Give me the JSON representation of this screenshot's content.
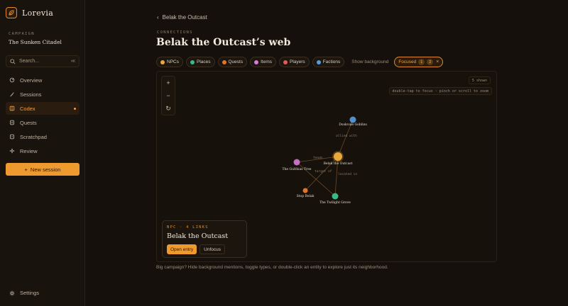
{
  "app": {
    "name": "Lorevia"
  },
  "campaign": {
    "label": "CAMPAIGN",
    "name": "The Sunken Citadel"
  },
  "search": {
    "placeholder": "Search...",
    "shortcut": "⌘K"
  },
  "nav": [
    {
      "label": "Overview",
      "icon": "grid-icon"
    },
    {
      "label": "Sessions",
      "icon": "quill-icon"
    },
    {
      "label": "Codex",
      "icon": "book-icon",
      "active": true
    },
    {
      "label": "Quests",
      "icon": "scroll-icon"
    },
    {
      "label": "Scratchpad",
      "icon": "note-icon"
    },
    {
      "label": "Review",
      "icon": "sparkle-icon"
    }
  ],
  "new_session": "New session",
  "settings": "Settings",
  "breadcrumb": {
    "back": "Belak the Outcast"
  },
  "page": {
    "eyebrow": "CONNECTIONS",
    "title": "Belak the Outcast’s web"
  },
  "filters": [
    {
      "label": "NPCs",
      "color": "#e8a93a"
    },
    {
      "label": "Places",
      "color": "#3ab88a"
    },
    {
      "label": "Quests",
      "color": "#e0742a"
    },
    {
      "label": "Items",
      "color": "#d77ad8"
    },
    {
      "label": "Players",
      "color": "#e05a5a"
    },
    {
      "label": "Factions",
      "color": "#5a9be0"
    }
  ],
  "show_background": "Show background",
  "focused": {
    "label": "Focused",
    "depth1": "1",
    "depth2": "2",
    "close": "×"
  },
  "graph": {
    "shown": "5 shown",
    "hint": "double-tap to focus · pinch or scroll to zoom",
    "zoom_in": "+",
    "zoom_out": "−",
    "reset": "↻",
    "nodes": {
      "center": "Belak the Outcast",
      "goblins": "Duskvale Goblins",
      "tree": "The Gulthias Tree",
      "stop": "Stop Belak",
      "grove": "The Twilight Grove"
    },
    "edges": {
      "allied": "allied with",
      "tends": "tends",
      "target": "target of",
      "located": "located in"
    }
  },
  "card": {
    "eyebrow": "NPC · 4 LINKS",
    "title": "Belak the Outcast",
    "open": "Open entry",
    "unfocus": "Unfocus"
  },
  "footer_hint": "Big campaign? Hide background mentions, toggle types, or double-click an entity to explore just its neighborhood."
}
